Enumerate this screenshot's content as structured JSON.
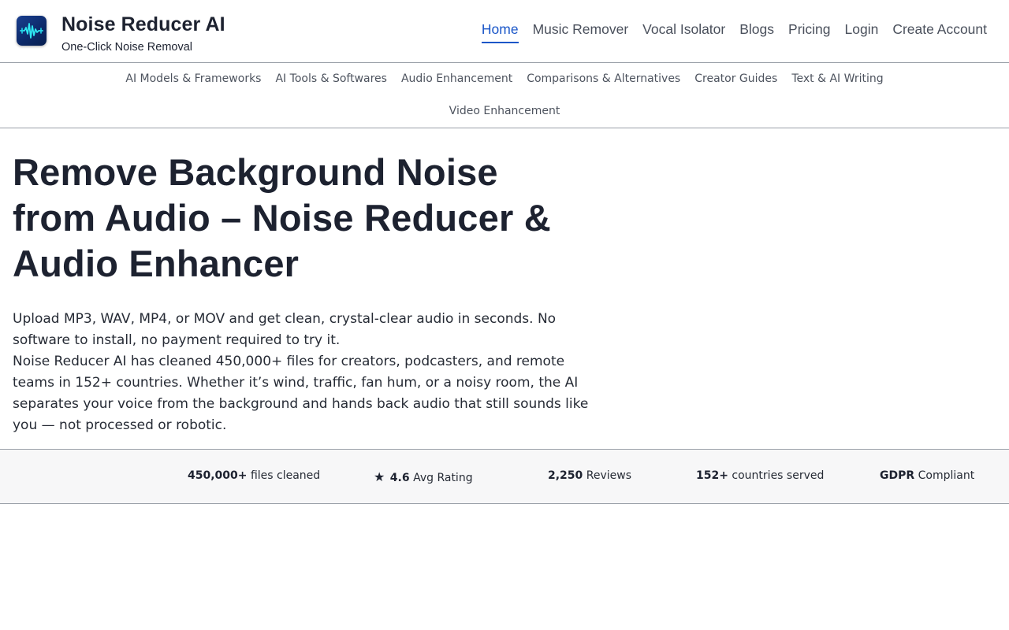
{
  "brand": {
    "name": "Noise Reducer AI",
    "tagline": "One-Click Noise Removal",
    "logo_icon": "waveform-icon",
    "logo_colors": [
      "#1a3f8f",
      "#082050",
      "#2ee6f0"
    ]
  },
  "main_nav": {
    "active_color": "#1a56c8",
    "items": [
      {
        "label": "Home",
        "active": true
      },
      {
        "label": "Music Remover",
        "active": false
      },
      {
        "label": "Vocal Isolator",
        "active": false
      },
      {
        "label": "Blogs",
        "active": false
      },
      {
        "label": "Pricing",
        "active": false
      },
      {
        "label": "Login",
        "active": false
      },
      {
        "label": "Create Account",
        "active": false
      }
    ]
  },
  "category_nav": {
    "items": [
      "AI Models & Frameworks",
      "AI Tools & Softwares",
      "Audio Enhancement",
      "Comparisons & Alternatives",
      "Creator Guides",
      "Text & AI Writing",
      "Video Enhancement"
    ]
  },
  "hero": {
    "title_lines": [
      "Remove Background Noise",
      "from Audio – Noise Reducer &",
      "Audio Enhancer"
    ],
    "para1": "Upload MP3, WAV, MP4, or MOV and get clean, crystal-clear audio in seconds. No software to install, no payment required to try it.",
    "para2": "Noise Reducer AI has cleaned 450,000+ files for creators, podcasters, and remote teams in 152+ countries. Whether it’s wind, traffic, fan hum, or a noisy room, the AI separates your voice from the background and hands back audio that still sounds like you — not processed or robotic."
  },
  "stats": {
    "files": {
      "value": "450,000+",
      "label": "files cleaned"
    },
    "rating": {
      "icon": "star-icon",
      "star": "★",
      "value": "4.6",
      "label": "Avg Rating"
    },
    "reviews": {
      "value": "2,250",
      "label": "Reviews"
    },
    "countries": {
      "value": "152+",
      "label": "countries served"
    },
    "gdpr": {
      "value": "GDPR",
      "label": "Compliant"
    }
  }
}
